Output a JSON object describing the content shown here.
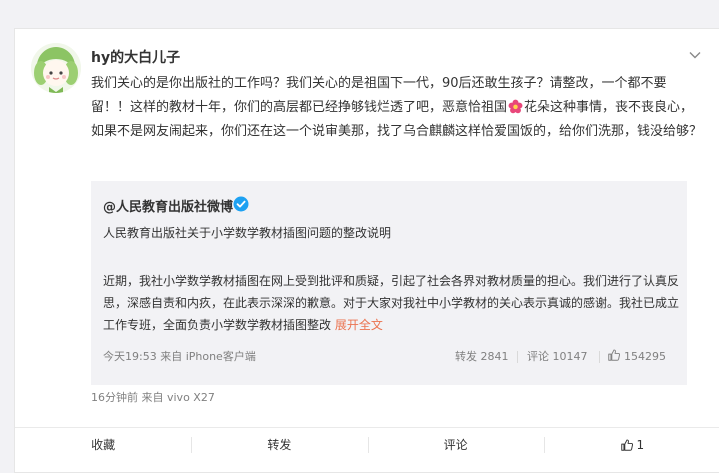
{
  "post": {
    "username": "hy的大白儿子",
    "text_part1": "我们关心的是你出版社的工作吗？我们关心的是祖国下一代，90后还敢生孩子？请整改，一个都不要留！！这样的教材十年，你们的高层都已经挣够钱烂透了吧，恶意恰祖国",
    "text_part2": "花朵这种事情，丧不丧良心，如果不是网友闹起来，你们还在这一个说审美那，找了乌合麒麟这样恰爱国饭的，给你们洗那，钱没给够？",
    "meta": "16分钟前  来自 vivo X27"
  },
  "repost": {
    "author": "@人民教育出版社微博",
    "headline": "人民教育出版社关于小学数学教材插图问题的整改说明",
    "body": "近期，我社小学数学教材插图在网上受到批评和质疑，引起了社会各界对教材质量的担心。我们进行了认真反思，深感自责和内疚，在此表示深深的歉意。对于大家对我社中小学教材的关心表示真诚的感谢。我社已成立工作专班，全面负责小学数学教材插图整改",
    "expand_label": "展开全文",
    "meta": "今天19:53 来自 iPhone客户端",
    "repost_count": "转发 2841",
    "comment_count": "评论 10147",
    "like_count": "154295"
  },
  "actions": {
    "favorite": "收藏",
    "repost": "转发",
    "comment": "评论",
    "like_count": "1"
  },
  "colors": {
    "accent": "#eb7350",
    "verified": "#1da1f2",
    "page_bg": "#f2f2f5"
  }
}
